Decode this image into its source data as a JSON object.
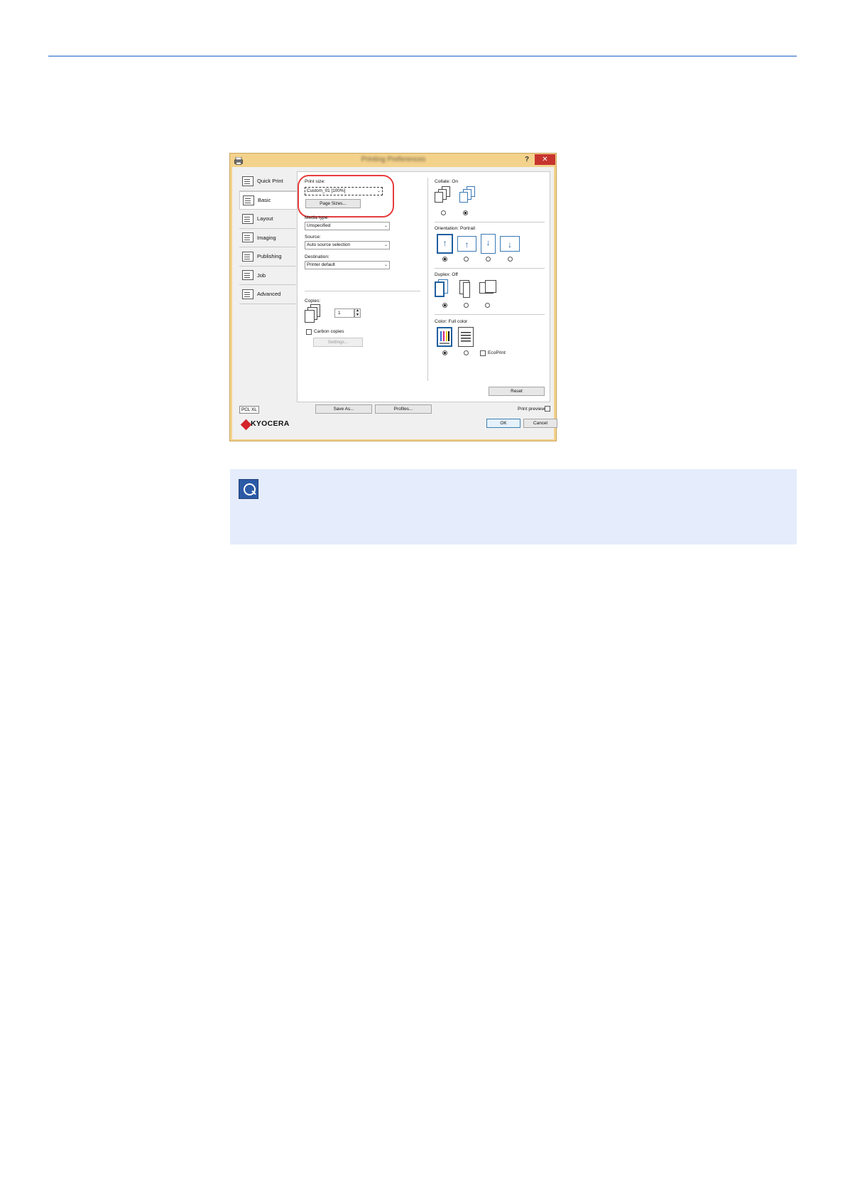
{
  "dialog": {
    "title": "Printing Preferences",
    "help_label": "?",
    "close_label": "✕"
  },
  "sidebar": {
    "items": [
      {
        "label": "Quick Print"
      },
      {
        "label": "Basic"
      },
      {
        "label": "Layout"
      },
      {
        "label": "Imaging"
      },
      {
        "label": "Publishing"
      },
      {
        "label": "Job"
      },
      {
        "label": "Advanced"
      }
    ]
  },
  "basic": {
    "print_size_label": "Print size:",
    "print_size_value": "Custom_01 [100%]",
    "page_sizes_button": "Page Sizes...",
    "media_type_label": "Media type:",
    "media_type_value": "Unspecified",
    "source_label": "Source:",
    "source_value": "Auto source selection",
    "destination_label": "Destination:",
    "destination_value": "Printer default",
    "copies_label": "Copies:",
    "copies_value": "1",
    "carbon_copies_label": "Carbon copies",
    "settings_button": "Settings...",
    "collate_label": "Collate:",
    "collate_value": "On",
    "orientation_label": "Orientation:",
    "orientation_value": "Portrait",
    "duplex_label": "Duplex:",
    "duplex_value": "Off",
    "color_label": "Color:",
    "color_value": "Full color",
    "ecoprint_label": "EcoPrint",
    "reset_button": "Reset"
  },
  "footer": {
    "pcl_label": "PCL XL",
    "save_as_button": "Save As...",
    "profiles_button": "Profiles...",
    "print_preview_label": "Print preview",
    "brand": "KYOCERA",
    "ok_button": "OK",
    "cancel_button": "Cancel"
  },
  "colors": {
    "highlight": "#e53d3d",
    "note_background": "#e5ecfb",
    "rule": "#7ea6e0"
  }
}
